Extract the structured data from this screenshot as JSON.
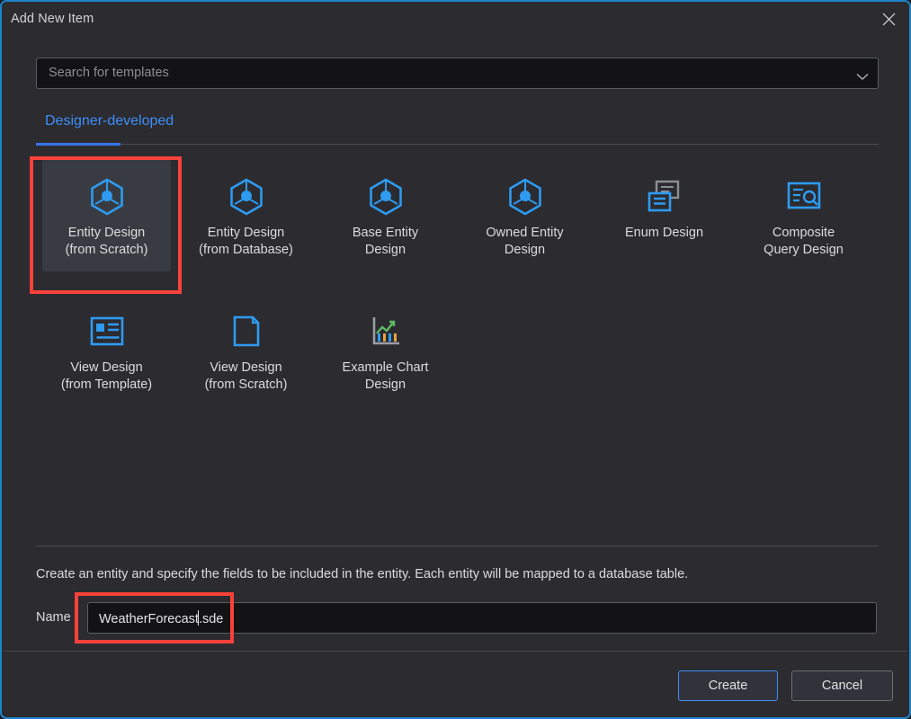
{
  "window": {
    "title": "Add New Item",
    "close_icon": "close-icon",
    "accent_color": "#1e83c8",
    "background_color": "#2b2b30"
  },
  "search": {
    "placeholder": "Search for templates",
    "value": "",
    "chevron_icon": "chevron-down-icon"
  },
  "tabs": [
    {
      "label": "Designer-developed",
      "selected": true
    }
  ],
  "templates": [
    {
      "label_line1": "Entity Design",
      "label_line2": "(from Scratch)",
      "icon": "entity-hexagon-icon",
      "selected": true
    },
    {
      "label_line1": "Entity Design",
      "label_line2": "(from Database)",
      "icon": "entity-hexagon-icon",
      "selected": false
    },
    {
      "label_line1": "Base Entity",
      "label_line2": "Design",
      "icon": "entity-hexagon-icon",
      "selected": false
    },
    {
      "label_line1": "Owned Entity",
      "label_line2": "Design",
      "icon": "entity-hexagon-icon",
      "selected": false
    },
    {
      "label_line1": "Enum Design",
      "label_line2": "",
      "icon": "enum-windows-icon",
      "selected": false
    },
    {
      "label_line1": "Composite",
      "label_line2": "Query Design",
      "icon": "query-search-icon",
      "selected": false
    },
    {
      "label_line1": "View Design",
      "label_line2": "(from Template)",
      "icon": "view-layout-icon",
      "selected": false
    },
    {
      "label_line1": "View Design",
      "label_line2": "(from Scratch)",
      "icon": "blank-page-icon",
      "selected": false
    },
    {
      "label_line1": "Example Chart",
      "label_line2": "Design",
      "icon": "chart-icon",
      "selected": false
    }
  ],
  "description": "Create an entity and specify the fields to be included in the entity.  Each entity will be mapped to a database table.",
  "name_field": {
    "label": "Name",
    "value_before_caret": "WeatherForecast",
    "value_after_caret": ".sde"
  },
  "footer": {
    "create_label": "Create",
    "cancel_label": "Cancel"
  },
  "annotations": {
    "color": "#f9423a",
    "items": [
      {
        "target": "entity-design-from-scratch-tile"
      },
      {
        "target": "name-input"
      }
    ]
  }
}
